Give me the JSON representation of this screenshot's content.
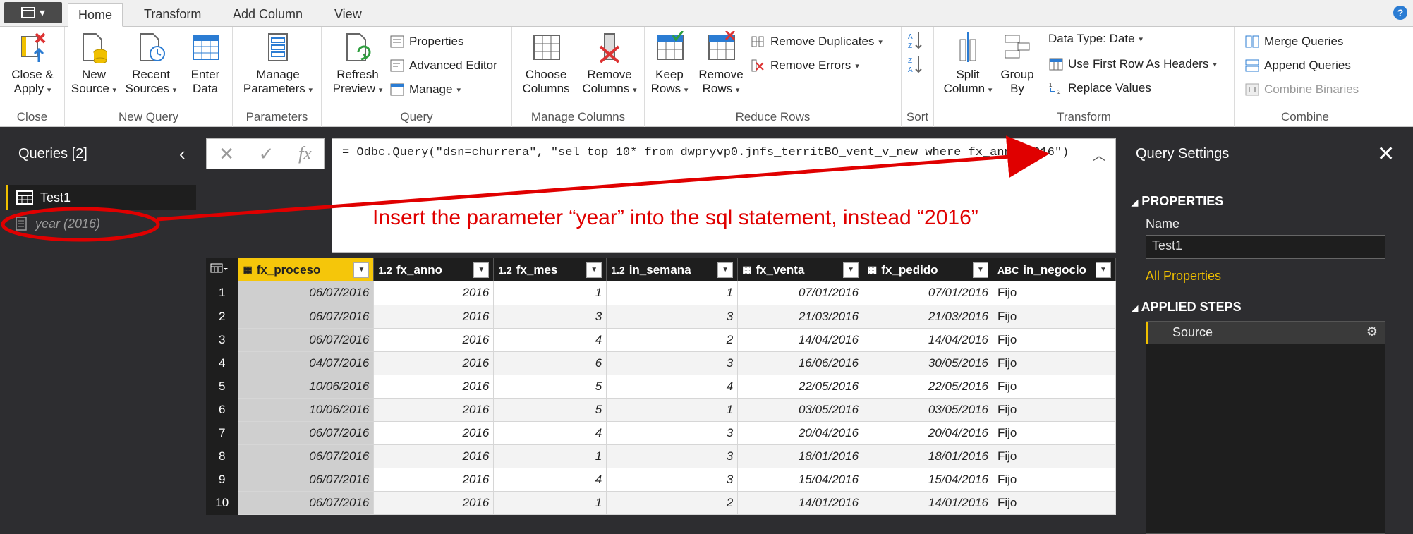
{
  "tabs": [
    {
      "label": "Home"
    },
    {
      "label": "Transform"
    },
    {
      "label": "Add Column"
    },
    {
      "label": "View"
    }
  ],
  "help_icon": "question-icon",
  "ribbon": {
    "close": {
      "label": "Close",
      "close_apply_1": "Close &",
      "close_apply_2": "Apply"
    },
    "new_query": {
      "label": "New Query",
      "new_source_1": "New",
      "new_source_2": "Source",
      "recent_1": "Recent",
      "recent_2": "Sources",
      "enter_1": "Enter",
      "enter_2": "Data"
    },
    "parameters": {
      "label": "Parameters",
      "manage_1": "Manage",
      "manage_2": "Parameters"
    },
    "query": {
      "label": "Query",
      "refresh_1": "Refresh",
      "refresh_2": "Preview",
      "properties": "Properties",
      "advanced": "Advanced Editor",
      "manage": "Manage"
    },
    "manage_columns": {
      "label": "Manage Columns",
      "choose_1": "Choose",
      "choose_2": "Columns",
      "remove_1": "Remove",
      "remove_2": "Columns"
    },
    "reduce_rows": {
      "label": "Reduce Rows",
      "keep_1": "Keep",
      "keep_2": "Rows",
      "remrows_1": "Remove",
      "remrows_2": "Rows",
      "remove_duplicates": "Remove Duplicates",
      "remove_errors": "Remove Errors"
    },
    "sort": {
      "label": "Sort"
    },
    "transform": {
      "label": "Transform",
      "split_1": "Split",
      "split_2": "Column",
      "group_1": "Group",
      "group_2": "By",
      "data_type": "Data Type: Date",
      "first_row": "Use First Row As Headers",
      "replace": "Replace Values"
    },
    "combine": {
      "label": "Combine",
      "merge": "Merge Queries",
      "append": "Append Queries",
      "binaries": "Combine Binaries"
    }
  },
  "queries_pane": {
    "title": "Queries [2]",
    "items": [
      {
        "label": "Test1"
      },
      {
        "label": "year (2016)"
      }
    ]
  },
  "formula_bar": {
    "cancel": "✕",
    "commit": "✓",
    "fx": "fx",
    "text": "= Odbc.Query(\"dsn=churrera\", \"sel top 10* from dwpryvp0.jnfs_territBO_vent_v_new where fx_anno=2016\")"
  },
  "annotation": "Insert the parameter “year” into the sql statement, instead “2016”",
  "annotation_color": "#e00000",
  "grid": {
    "columns": [
      {
        "type": "calendar-icon",
        "name": "fx_proceso"
      },
      {
        "type": "1.2",
        "name": "fx_anno"
      },
      {
        "type": "1.2",
        "name": "fx_mes"
      },
      {
        "type": "1.2",
        "name": "in_semana"
      },
      {
        "type": "calendar-icon",
        "name": "fx_venta"
      },
      {
        "type": "calendar-icon",
        "name": "fx_pedido"
      },
      {
        "type": "ABC",
        "name": "in_negocio"
      }
    ],
    "rows": [
      [
        "1",
        "06/07/2016",
        "2016",
        "1",
        "1",
        "07/01/2016",
        "07/01/2016",
        "Fijo"
      ],
      [
        "2",
        "06/07/2016",
        "2016",
        "3",
        "3",
        "21/03/2016",
        "21/03/2016",
        "Fijo"
      ],
      [
        "3",
        "06/07/2016",
        "2016",
        "4",
        "2",
        "14/04/2016",
        "14/04/2016",
        "Fijo"
      ],
      [
        "4",
        "04/07/2016",
        "2016",
        "6",
        "3",
        "16/06/2016",
        "30/05/2016",
        "Fijo"
      ],
      [
        "5",
        "10/06/2016",
        "2016",
        "5",
        "4",
        "22/05/2016",
        "22/05/2016",
        "Fijo"
      ],
      [
        "6",
        "10/06/2016",
        "2016",
        "5",
        "1",
        "03/05/2016",
        "03/05/2016",
        "Fijo"
      ],
      [
        "7",
        "06/07/2016",
        "2016",
        "4",
        "3",
        "20/04/2016",
        "20/04/2016",
        "Fijo"
      ],
      [
        "8",
        "06/07/2016",
        "2016",
        "1",
        "3",
        "18/01/2016",
        "18/01/2016",
        "Fijo"
      ],
      [
        "9",
        "06/07/2016",
        "2016",
        "4",
        "3",
        "15/04/2016",
        "15/04/2016",
        "Fijo"
      ],
      [
        "10",
        "06/07/2016",
        "2016",
        "1",
        "2",
        "14/01/2016",
        "14/01/2016",
        "Fijo"
      ]
    ]
  },
  "settings_pane": {
    "title": "Query Settings",
    "properties": "PROPERTIES",
    "name_label": "Name",
    "name_value": "Test1",
    "all_properties": "All Properties",
    "applied_steps": "APPLIED STEPS",
    "steps": [
      {
        "label": "Source"
      }
    ]
  }
}
